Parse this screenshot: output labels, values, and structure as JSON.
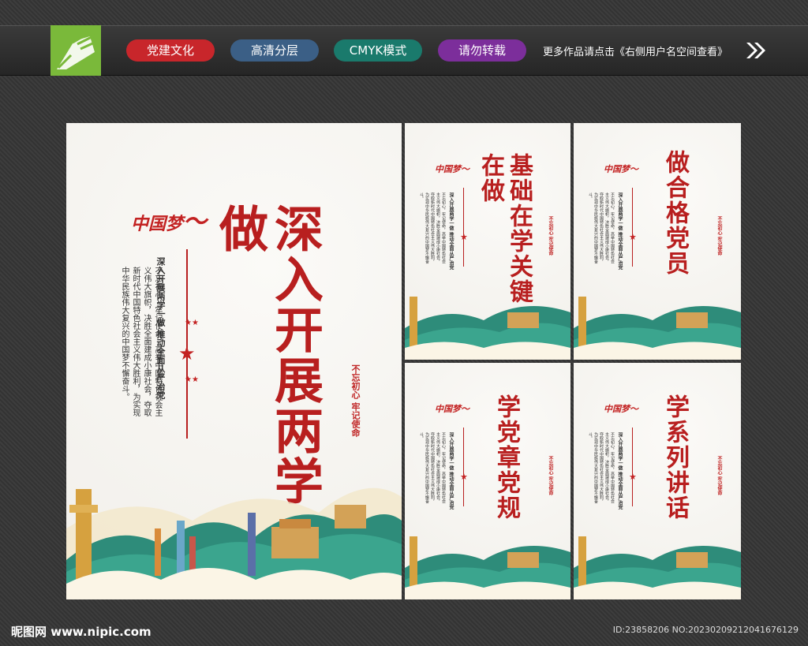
{
  "header": {
    "tags": [
      {
        "label": "党建文化",
        "color": "#c8262b"
      },
      {
        "label": "高清分层",
        "color": "#3b5f86"
      },
      {
        "label": "CMYK模式",
        "color": "#1a7a6c"
      },
      {
        "label": "请勿转载",
        "color": "#7c2e9b"
      }
    ],
    "note": "更多作品请点击《右侧用户名空间查看》"
  },
  "posters": {
    "main": {
      "title": "深入开展两学一做",
      "subtitle": "深入开展两学一做 推动全面从严治党",
      "body": "不忘初心，牢记使命，高举中国特色社会主义伟大旗帜，决胜全面建成小康社会，夺取新时代中国特色社会主义伟大胜利，为实现中华民族伟大复兴的中国梦不懈奋斗。",
      "slogan": "不忘初心 牢记使命",
      "logo": "中国梦"
    },
    "small": [
      {
        "title": "基础在学关键在做"
      },
      {
        "title": "做合格党员"
      },
      {
        "title": "学党章党规"
      },
      {
        "title": "学系列讲话"
      }
    ],
    "small_subtitle": "深入开展两学一做 推动全面从严治党",
    "small_body": "不忘初心，牢记使命，高举中国特色社会主义伟大旗帜，决胜全面建成小康社会，夺取新时代中国特色社会主义伟大胜利，为实现中华民族伟大复兴的中国梦不懈奋斗。",
    "small_slogan": "不忘初心 牢记使命",
    "small_logo": "中国梦"
  },
  "watermark": {
    "site": "昵图网 www.nipic.com",
    "id": "ID:23858206 NO:20230209212041676129"
  }
}
